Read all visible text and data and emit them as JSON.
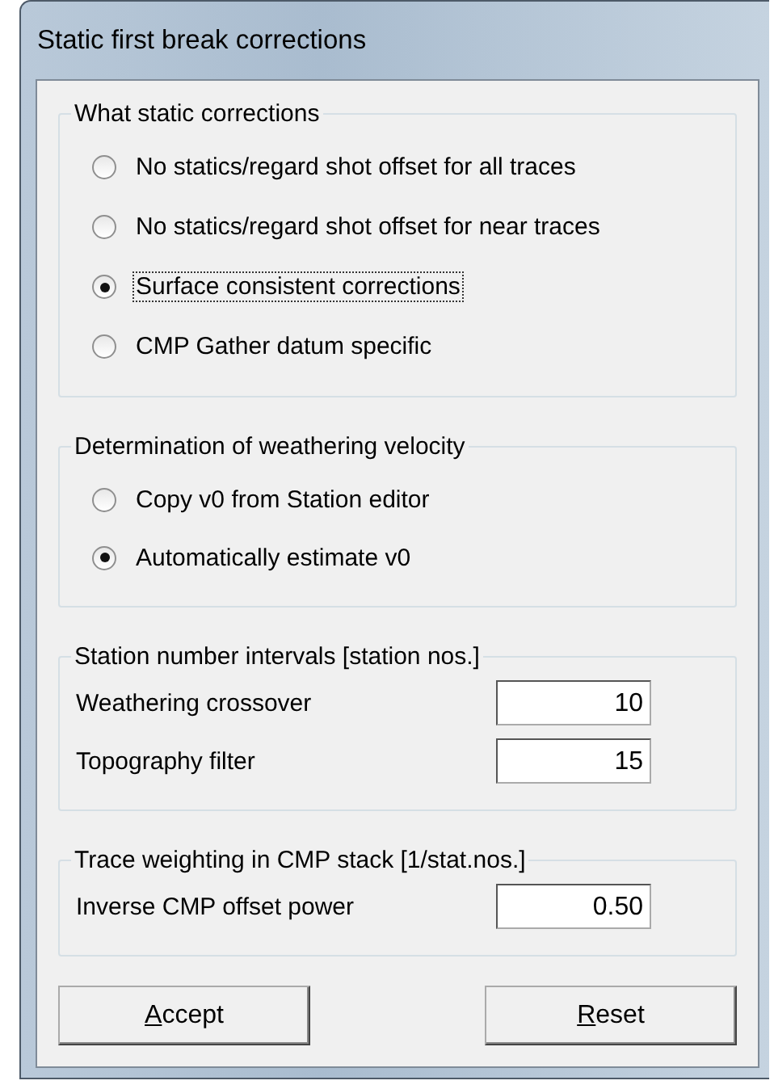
{
  "window": {
    "title": "Static first break corrections"
  },
  "groups": [
    {
      "kind": "radio",
      "title": "What static corrections",
      "options": [
        {
          "label": "No statics/regard shot offset for all traces",
          "selected": false,
          "focused": false
        },
        {
          "label": "No statics/regard shot offset for near traces",
          "selected": false,
          "focused": false
        },
        {
          "label": "Surface consistent corrections",
          "selected": true,
          "focused": true
        },
        {
          "label": "CMP Gather datum specific",
          "selected": false,
          "focused": false
        }
      ]
    },
    {
      "kind": "radio",
      "title": "Determination of weathering velocity",
      "options": [
        {
          "label": "Copy v0 from Station editor",
          "selected": false,
          "focused": false
        },
        {
          "label": "Automatically estimate v0",
          "selected": true,
          "focused": false
        }
      ]
    },
    {
      "kind": "fields",
      "title": "Station number intervals [station nos.]",
      "fields": [
        {
          "label": "Weathering crossover",
          "value": "10"
        },
        {
          "label": "Topography filter",
          "value": "15"
        }
      ]
    },
    {
      "kind": "fields",
      "title": "Trace weighting in CMP stack [1/stat.nos.]",
      "fields": [
        {
          "label": "Inverse CMP offset power",
          "value": "0.50"
        }
      ]
    }
  ],
  "buttons": [
    "Accept",
    "Reset"
  ]
}
